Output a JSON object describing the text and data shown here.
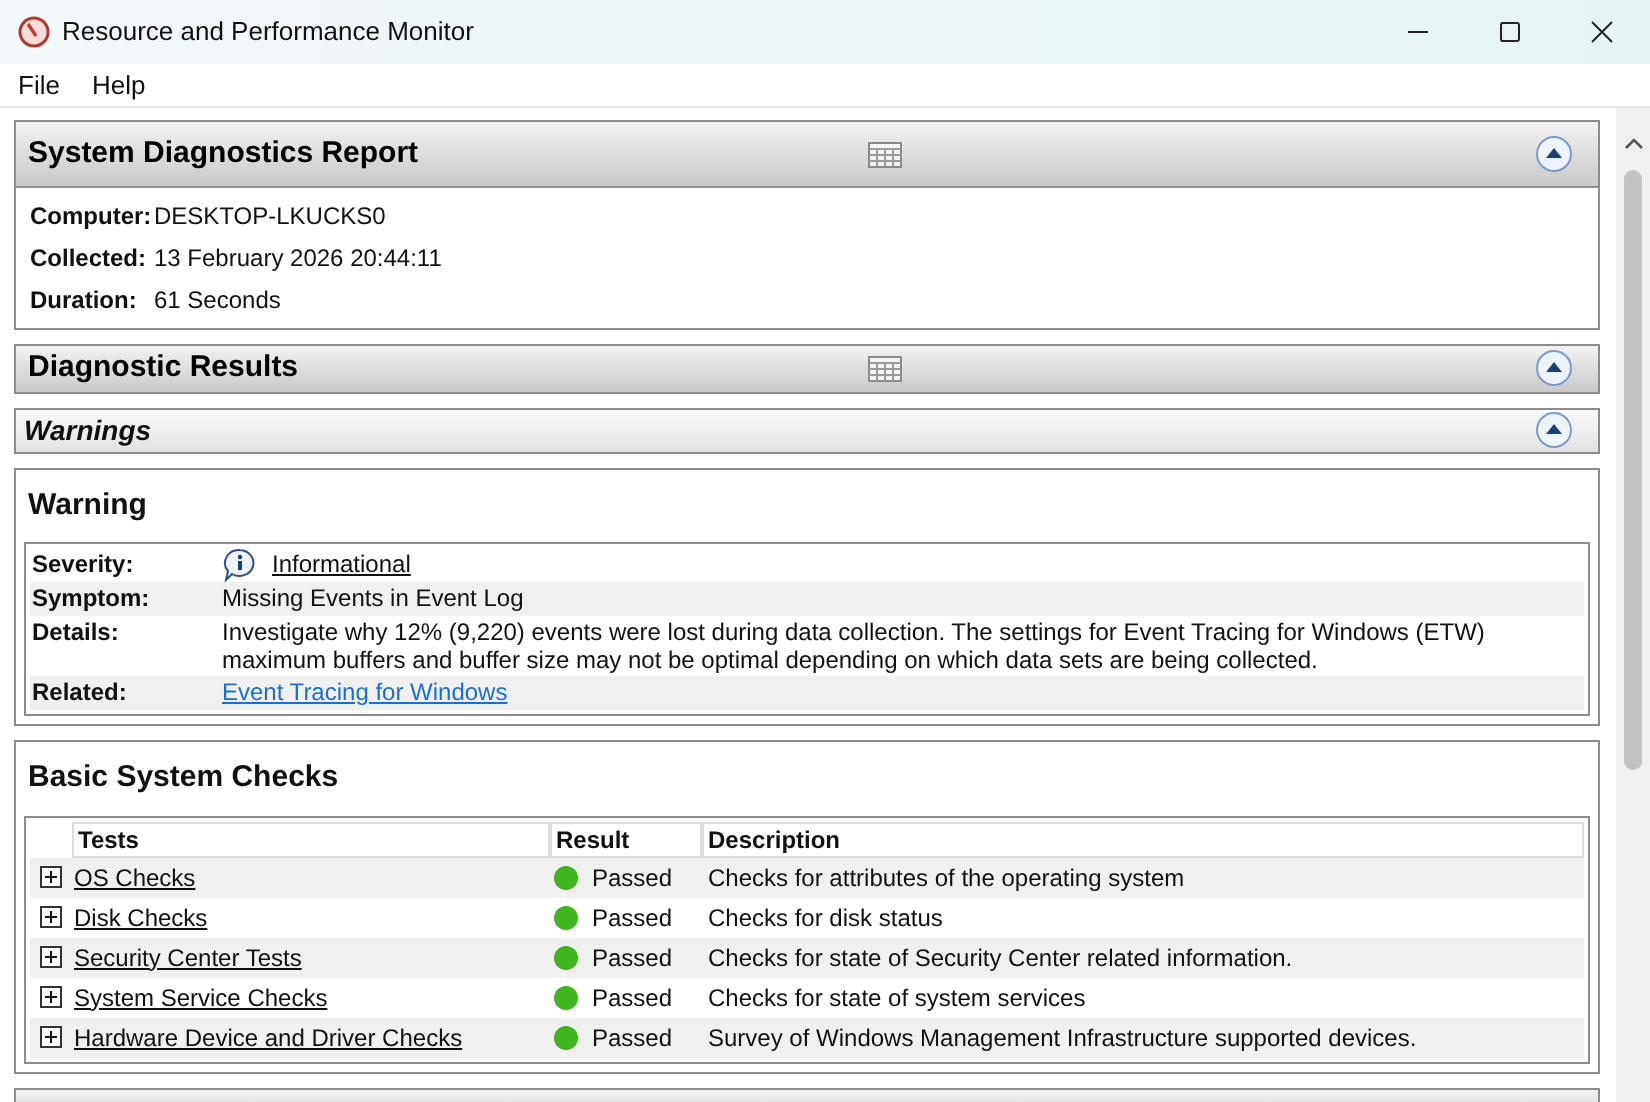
{
  "window": {
    "title": "Resource and Performance Monitor"
  },
  "menu": [
    "File",
    "Help"
  ],
  "report": {
    "title": "System Diagnostics Report",
    "expanded": true,
    "fields": [
      {
        "label": "Computer:",
        "value": "DESKTOP-LKUCKS0"
      },
      {
        "label": "Collected:",
        "value": "13 February 2026 20:44:11"
      },
      {
        "label": "Duration:",
        "value": "61 Seconds"
      }
    ]
  },
  "diagnostic_results": {
    "title": "Diagnostic Results",
    "expanded": true
  },
  "warnings": {
    "title": "Warnings",
    "expanded": true
  },
  "warning": {
    "title": "Warning",
    "rows": [
      {
        "kind": "info-link",
        "label": "Severity:",
        "value": "Informational"
      },
      {
        "kind": "text",
        "label": "Symptom:",
        "value": "Missing Events in Event Log"
      },
      {
        "kind": "text",
        "label": "Details:",
        "value": "Investigate why 12% (9,220) events were lost during data collection. The settings for Event Tracing for Windows (ETW) maximum buffers and buffer size may not be optimal depending on which data sets are being collected."
      },
      {
        "kind": "link",
        "label": "Related:",
        "value": "Event Tracing for Windows"
      }
    ]
  },
  "basic_checks": {
    "title": "Basic System Checks",
    "columns": [
      "Tests",
      "Result",
      "Description"
    ],
    "rows": [
      {
        "test": "OS Checks",
        "expanded": false,
        "color": "#3fb51f",
        "result": "Passed",
        "description": "Checks for attributes of the operating system"
      },
      {
        "test": "Disk Checks",
        "expanded": false,
        "color": "#3fb51f",
        "result": "Passed",
        "description": "Checks for disk status"
      },
      {
        "test": "Security Center Tests",
        "expanded": false,
        "color": "#3fb51f",
        "result": "Passed",
        "description": "Checks for state of Security Center related information."
      },
      {
        "test": "System Service Checks",
        "expanded": false,
        "color": "#3fb51f",
        "result": "Passed",
        "description": "Checks for state of system services"
      },
      {
        "test": "Hardware Device and Driver Checks",
        "expanded": false,
        "color": "#3fb51f",
        "result": "Passed",
        "description": "Survey of Windows Management Infrastructure supported devices."
      }
    ]
  }
}
